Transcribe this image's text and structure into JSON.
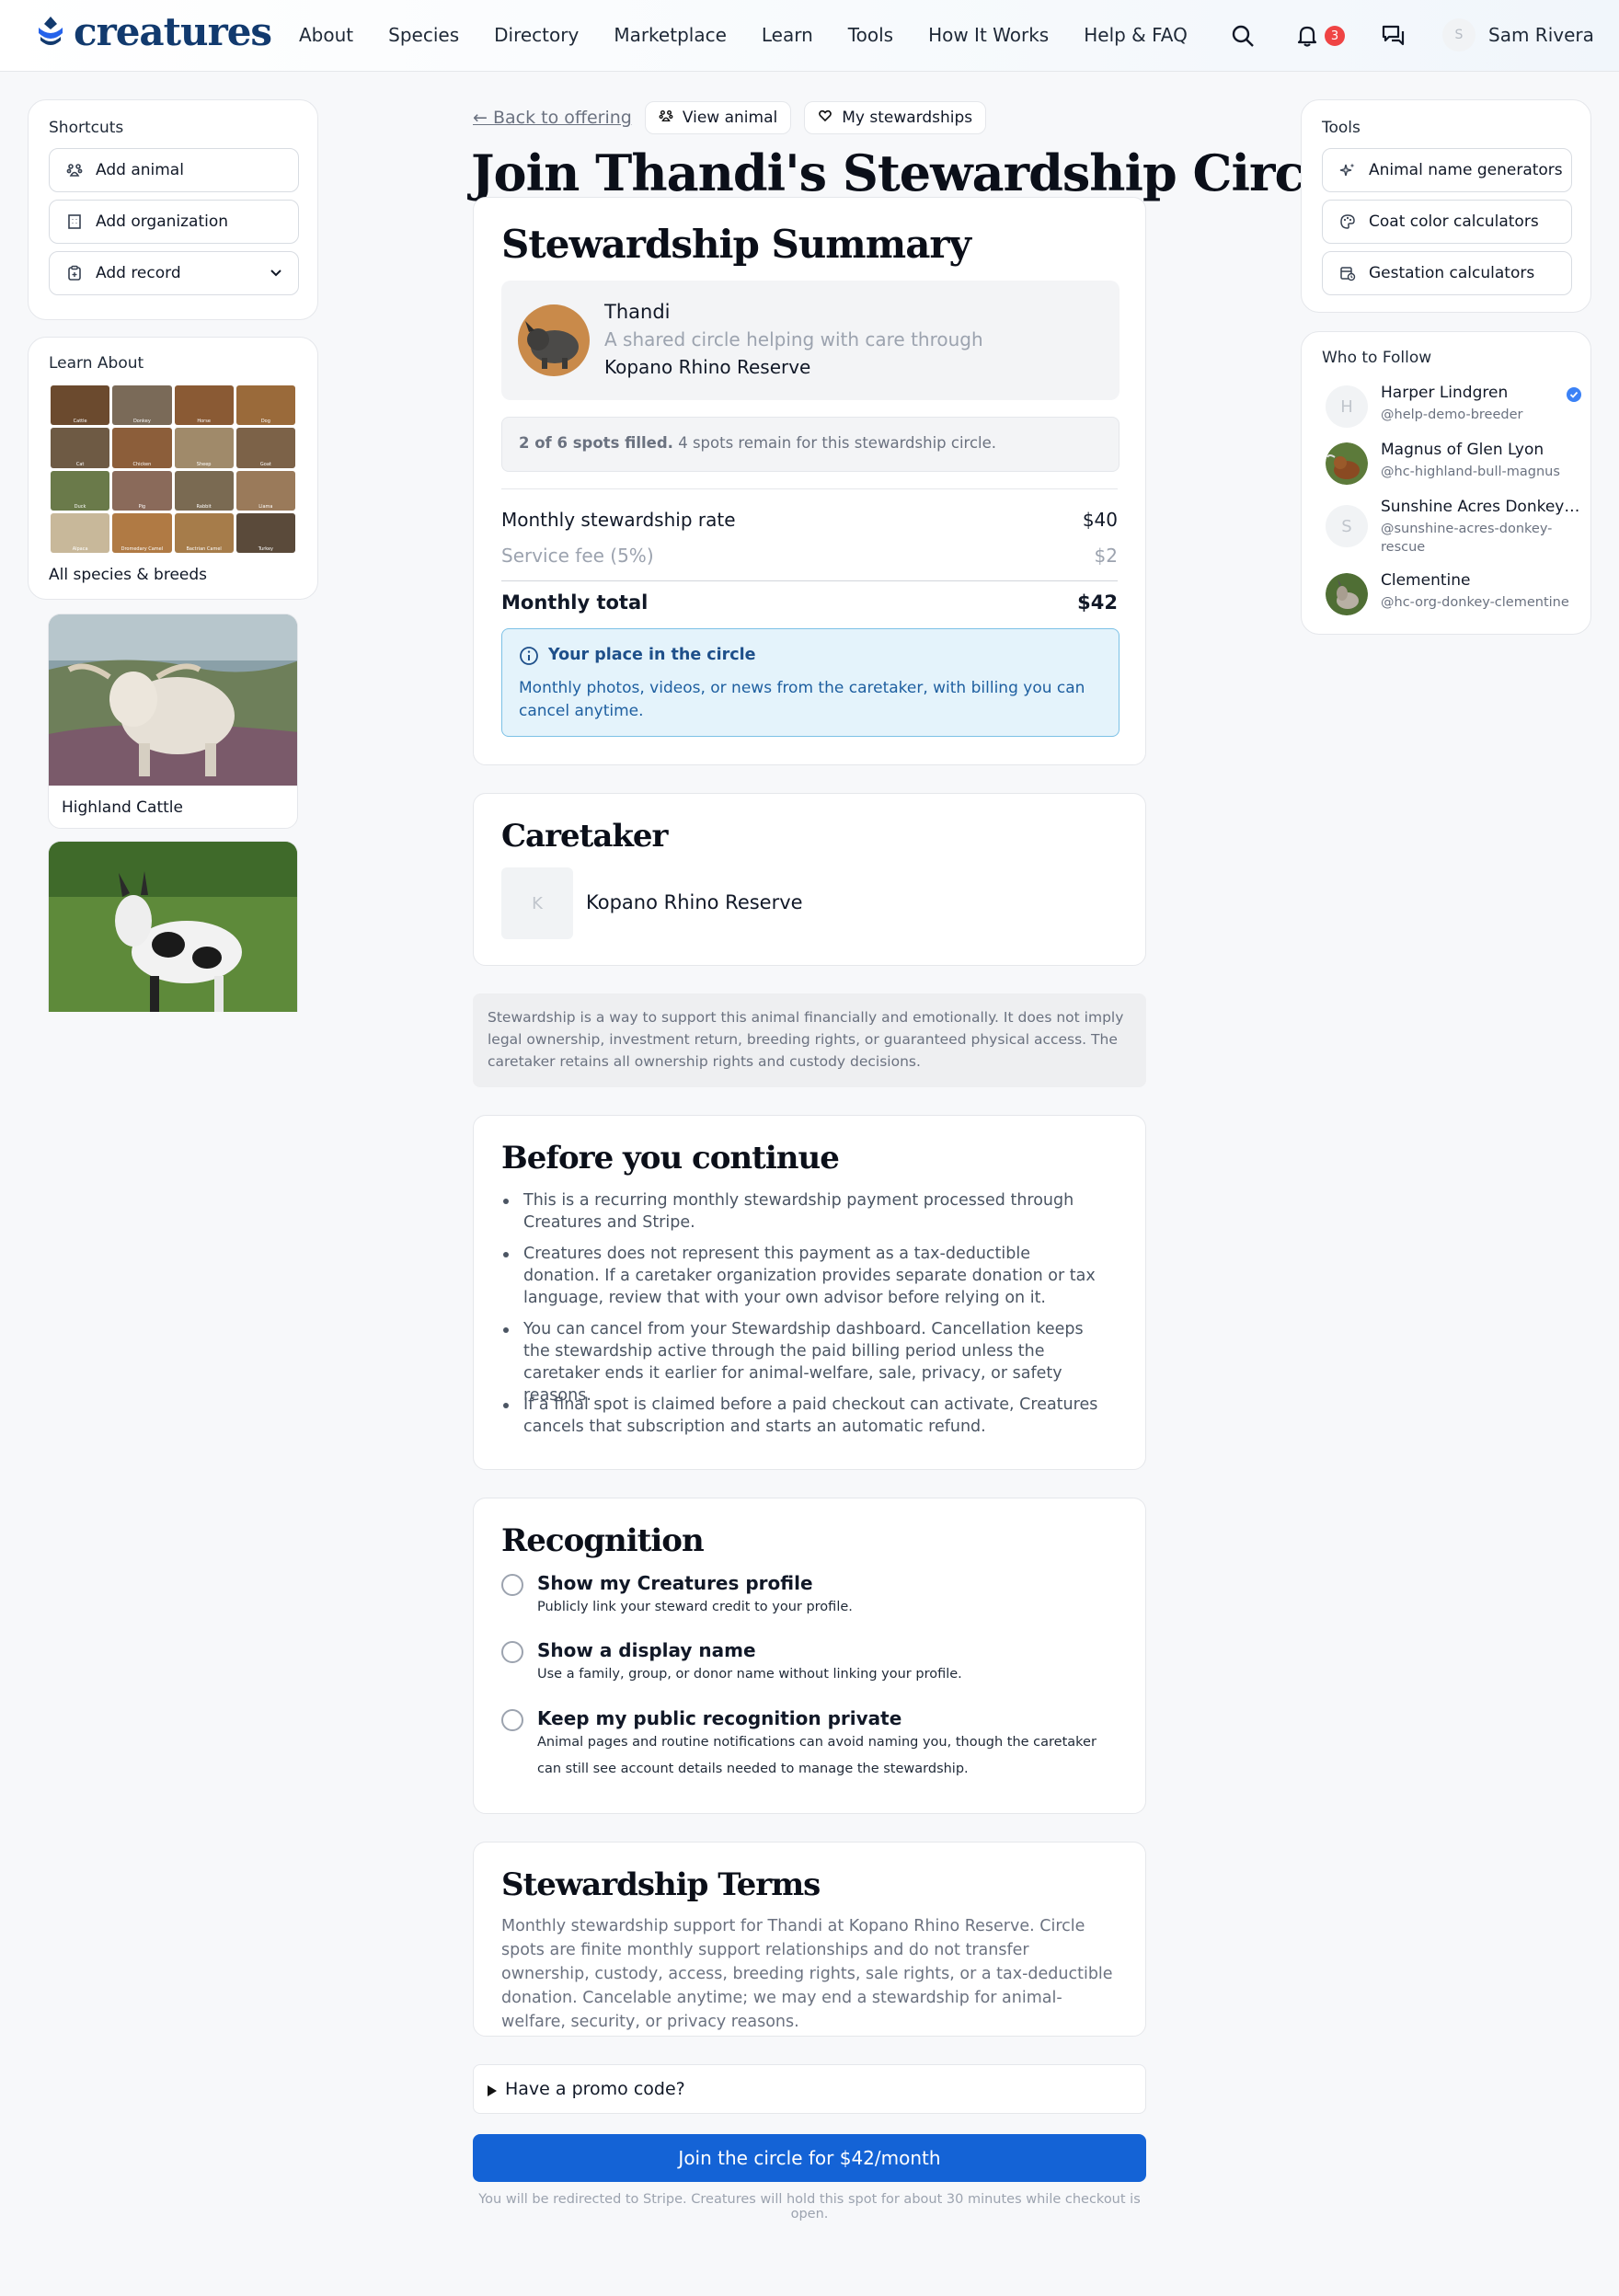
{
  "header": {
    "brand": "creatures",
    "nav": [
      "About",
      "Species",
      "Directory",
      "Marketplace",
      "Learn",
      "Tools",
      "How It Works",
      "Help & FAQ"
    ],
    "notification_count": "3",
    "user_initial": "S",
    "user_name": "Sam Rivera"
  },
  "shortcuts": {
    "title": "Shortcuts",
    "items": [
      "Add animal",
      "Add organization",
      "Add record"
    ]
  },
  "learn_about": {
    "title": "Learn About",
    "grid_labels": [
      "Cattle",
      "Donkey",
      "Horse",
      "Dog",
      "Cat",
      "Chicken",
      "Sheep",
      "Goat",
      "Duck",
      "Pig",
      "Rabbit",
      "Llama",
      "Alpaca",
      "Dromedary Camel",
      "Bactrian Camel",
      "Turkey"
    ],
    "grid_colors": [
      "#6b4a2e",
      "#7a6a58",
      "#8a5a34",
      "#9a6a3a",
      "#6e5a44",
      "#8c5e3a",
      "#a08a6a",
      "#7c6248",
      "#6a7a4a",
      "#8a6a5a",
      "#7a6a52",
      "#9a7a5a",
      "#c8b89a",
      "#b07a44",
      "#a67c4a",
      "#5a4a3a"
    ],
    "all_label": "All species & breeds",
    "featured": [
      {
        "name": "Highland Cattle"
      },
      {
        "name": ""
      }
    ]
  },
  "breadcrumbs": {
    "back": "← Back to offering",
    "view_animal": "View animal",
    "my_stewardships": "My stewardships"
  },
  "page_title": "Join Thandi's Stewardship Circle",
  "summary": {
    "title": "Stewardship Summary",
    "animal_name": "Thandi",
    "animal_desc": "A shared circle helping with care through",
    "animal_org": "Kopano Rhino Reserve",
    "spots_bold": "2 of 6 spots filled.",
    "spots_rest": " 4 spots remain for this stewardship circle.",
    "rate_label": "Monthly stewardship rate",
    "rate_value": "$40",
    "fee_label": "Service fee (5%)",
    "fee_value": "$2",
    "total_label": "Monthly total",
    "total_value": "$42",
    "info_title": "Your place in the circle",
    "info_text": "Monthly photos, videos, or news from the caretaker, with billing you can cancel anytime."
  },
  "caretaker": {
    "title": "Caretaker",
    "initial": "K",
    "name": "Kopano Rhino Reserve"
  },
  "disclaimer": "Stewardship is a way to support this animal financially and emotionally. It does not imply legal ownership, investment return, breeding rights, or guaranteed physical access. The caretaker retains all ownership rights and custody decisions.",
  "before": {
    "title": "Before you continue",
    "items": [
      "This is a recurring monthly stewardship payment processed through Creatures and Stripe.",
      "Creatures does not represent this payment as a tax-deductible donation. If a caretaker organization provides separate donation or tax language, review that with your own advisor before relying on it.",
      "You can cancel from your Stewardship dashboard. Cancellation keeps the stewardship active through the paid billing period unless the caretaker ends it earlier for animal-welfare, sale, privacy, or safety reasons.",
      "If a final spot is claimed before a paid checkout can activate, Creatures cancels that subscription and starts an automatic refund."
    ]
  },
  "recognition": {
    "title": "Recognition",
    "options": [
      {
        "title": "Show my Creatures profile",
        "desc": "Publicly link your steward credit to your profile."
      },
      {
        "title": "Show a display name",
        "desc": "Use a family, group, or donor name without linking your profile."
      },
      {
        "title": "Keep my public recognition private",
        "desc": "Animal pages and routine notifications can avoid naming you, though the caretaker can still see account details needed to manage the stewardship."
      }
    ]
  },
  "terms": {
    "title": "Stewardship Terms",
    "text": "Monthly stewardship support for Thandi at Kopano Rhino Reserve. Circle spots are finite monthly support relationships and do not transfer ownership, custody, access, breeding rights, sale rights, or a tax-deductible donation. Cancelable anytime; we may end a stewardship for animal-welfare, security, or privacy reasons."
  },
  "promo": "Have a promo code?",
  "cta": "Join the circle for $42/month",
  "redirect_note": "You will be redirected to Stripe. Creatures will hold this spot for about 30 minutes while checkout is open.",
  "tools": {
    "title": "Tools",
    "items": [
      "Animal name generators",
      "Coat color calculators",
      "Gestation calculators"
    ]
  },
  "who_to_follow": {
    "title": "Who to Follow",
    "people": [
      {
        "name": "Harper Lindgren",
        "handle": "@help-demo-breeder",
        "initial": "H"
      },
      {
        "name": "Magnus of Glen Lyon",
        "handle": "@hc-highland-bull-magnus",
        "initial": ""
      },
      {
        "name": "Sunshine Acres Donkey Rescue",
        "handle": "@sunshine-acres-donkey-rescue",
        "initial": "S"
      },
      {
        "name": "Clementine",
        "handle": "@hc-org-donkey-clementine",
        "initial": ""
      }
    ]
  }
}
